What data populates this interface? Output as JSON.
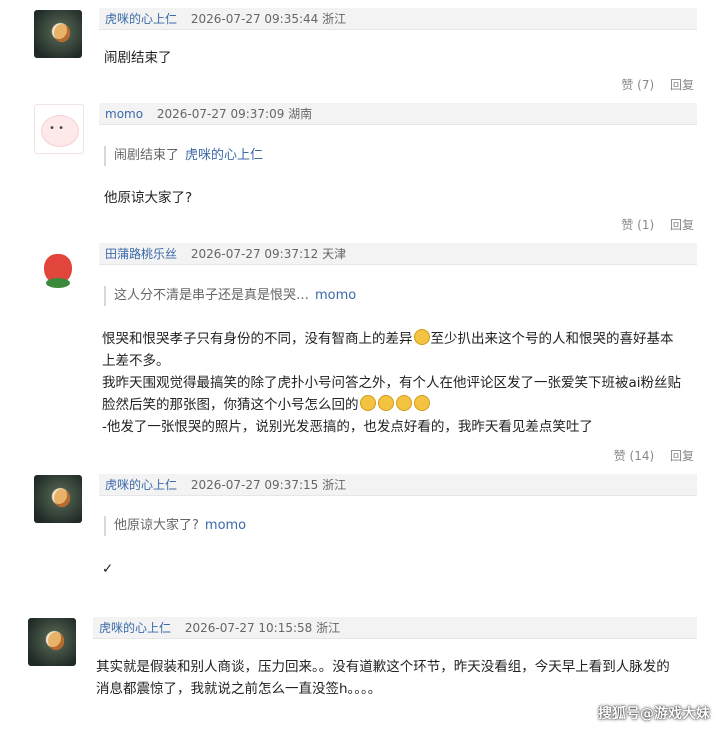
{
  "comments": [
    {
      "username": "虎咪的心上仁",
      "meta": "2026-07-27 09:35:44 浙江",
      "text": "闹剧结束了",
      "like": "赞 (7)",
      "reply": "回复"
    },
    {
      "username": "momo",
      "meta": "2026-07-27 09:37:09 湖南",
      "quote_text": "闹剧结束了",
      "quote_name": "虎咪的心上仁",
      "text": "他原谅大家了?",
      "like": "赞 (1)",
      "reply": "回复"
    },
    {
      "username": "田蒲路桃乐丝",
      "meta": "2026-07-27 09:37:12 天津",
      "quote_text": "这人分不清是串子还是真是恨哭…",
      "quote_name": "momo",
      "line1": "恨哭和恨哭孝子只有身份的不同，没有智商上的差异",
      "line1b": "至少扒出来这个号的人和恨哭的喜好基本",
      "line2": "上差不多。",
      "line3": "我昨天围观觉得最搞笑的除了虎扑小号问答之外，有个人在他评论区发了一张爱笑下班被ai粉丝贴",
      "line4": "脸然后笑的那张图，你猜这个小号怎么回的",
      "line5": "-他发了一张恨哭的照片，说别光发恶搞的，也发点好看的，我昨天看见差点笑吐了",
      "like": "赞 (14)",
      "reply": "回复"
    },
    {
      "username": "虎咪的心上仁",
      "meta": "2026-07-27 09:37:15 浙江",
      "quote_text": "他原谅大家了?",
      "quote_name": "momo",
      "text": "✓"
    },
    {
      "username": "虎咪的心上仁",
      "meta": "2026-07-27 10:15:58 浙江",
      "line1": "其实就是假装和别人商谈，压力回来。。没有道歉这个环节，昨天没看组，今天早上看到人脉发的",
      "line2": "消息都震惊了，我就说之前怎么一直没签h。。。。"
    }
  ],
  "watermark": "搜狐号@游戏大妹"
}
